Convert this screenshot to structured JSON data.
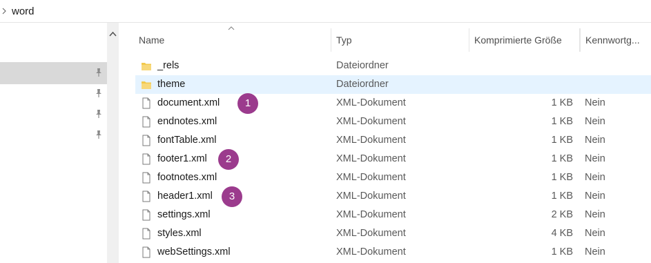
{
  "address": {
    "path": "word"
  },
  "columns": {
    "name": "Name",
    "type": "Typ",
    "compressed_size": "Komprimierte Größe",
    "password": "Kennwortg..."
  },
  "files": [
    {
      "name": "_rels",
      "type": "Dateiordner",
      "size": "",
      "password": "",
      "icon": "folder-icon"
    },
    {
      "name": "theme",
      "type": "Dateiordner",
      "size": "",
      "password": "",
      "icon": "folder-icon",
      "selected": true
    },
    {
      "name": "document.xml",
      "type": "XML-Dokument",
      "size": "1 KB",
      "password": "Nein",
      "icon": "file-icon"
    },
    {
      "name": "endnotes.xml",
      "type": "XML-Dokument",
      "size": "1 KB",
      "password": "Nein",
      "icon": "file-icon"
    },
    {
      "name": "fontTable.xml",
      "type": "XML-Dokument",
      "size": "1 KB",
      "password": "Nein",
      "icon": "file-icon"
    },
    {
      "name": "footer1.xml",
      "type": "XML-Dokument",
      "size": "1 KB",
      "password": "Nein",
      "icon": "file-icon"
    },
    {
      "name": "footnotes.xml",
      "type": "XML-Dokument",
      "size": "1 KB",
      "password": "Nein",
      "icon": "file-icon"
    },
    {
      "name": "header1.xml",
      "type": "XML-Dokument",
      "size": "1 KB",
      "password": "Nein",
      "icon": "file-icon"
    },
    {
      "name": "settings.xml",
      "type": "XML-Dokument",
      "size": "2 KB",
      "password": "Nein",
      "icon": "file-icon"
    },
    {
      "name": "styles.xml",
      "type": "XML-Dokument",
      "size": "4 KB",
      "password": "Nein",
      "icon": "file-icon"
    },
    {
      "name": "webSettings.xml",
      "type": "XML-Dokument",
      "size": "1 KB",
      "password": "Nein",
      "icon": "file-icon"
    }
  ],
  "markers": [
    {
      "label": "1",
      "row": 2
    },
    {
      "label": "2",
      "row": 5
    },
    {
      "label": "3",
      "row": 7
    }
  ],
  "colors": {
    "selection": "#e5f3ff",
    "folder": "#f2c94c",
    "marker": "#9b3b8d"
  },
  "icons": {
    "address_chevron": "chevron-right-icon",
    "nav_pins": [
      "pin-icon",
      "pin-icon",
      "pin-icon",
      "pin-icon"
    ],
    "scroll_up": "scroll-up-arrow-icon",
    "sort": "sort-ascending-icon"
  }
}
